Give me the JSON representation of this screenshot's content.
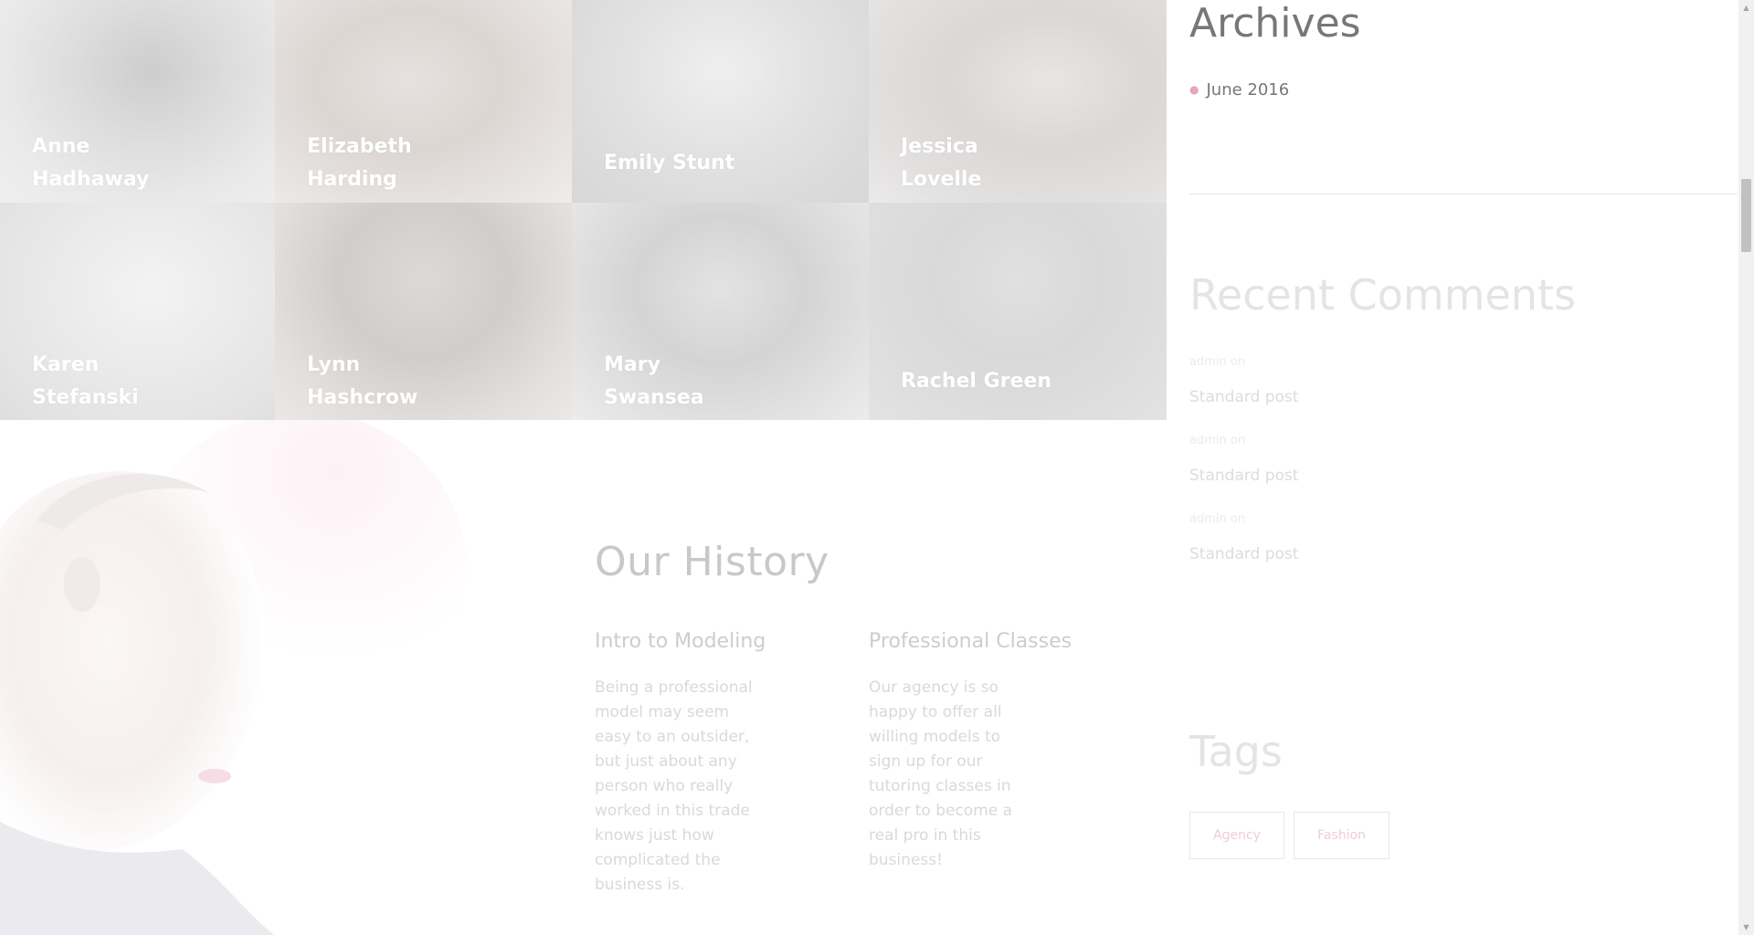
{
  "models": [
    {
      "first": "Anne",
      "last": "Hadhaway"
    },
    {
      "first": "Elizabeth",
      "last": "Harding"
    },
    {
      "first": "Emily Stunt",
      "last": ""
    },
    {
      "first": "Jessica",
      "last": "Lovelle"
    },
    {
      "first": "Karen",
      "last": "Stefanski"
    },
    {
      "first": "Lynn",
      "last": "Hashcrow"
    },
    {
      "first": "Mary",
      "last": "Swansea"
    },
    {
      "first": "Rachel Green",
      "last": ""
    }
  ],
  "history": {
    "title": "Our History",
    "col1": {
      "title": "Intro to Modeling",
      "text": "Being a professional model may seem easy to an outsider, but just about any person who really worked in this trade knows just how complicated the business is."
    },
    "col2": {
      "title": "Professional Classes",
      "text": "Our agency is so happy to offer all willing models to sign up for our tutoring classes in order to become a real pro in this business!"
    }
  },
  "sidebar": {
    "archives_title": "Archives",
    "archive_item": "June 2016",
    "recent_comments_title": "Recent Comments",
    "comments": [
      {
        "meta": "admin on",
        "post": "Standard post"
      },
      {
        "meta": "admin on",
        "post": "Standard post"
      },
      {
        "meta": "admin on",
        "post": "Standard post"
      }
    ],
    "tags_title": "Tags",
    "tags": [
      "Agency",
      "Fashion"
    ]
  },
  "colors": {
    "accent": "#e0386e",
    "heading": "#777777",
    "faded_heading": "#e4e4e4"
  }
}
